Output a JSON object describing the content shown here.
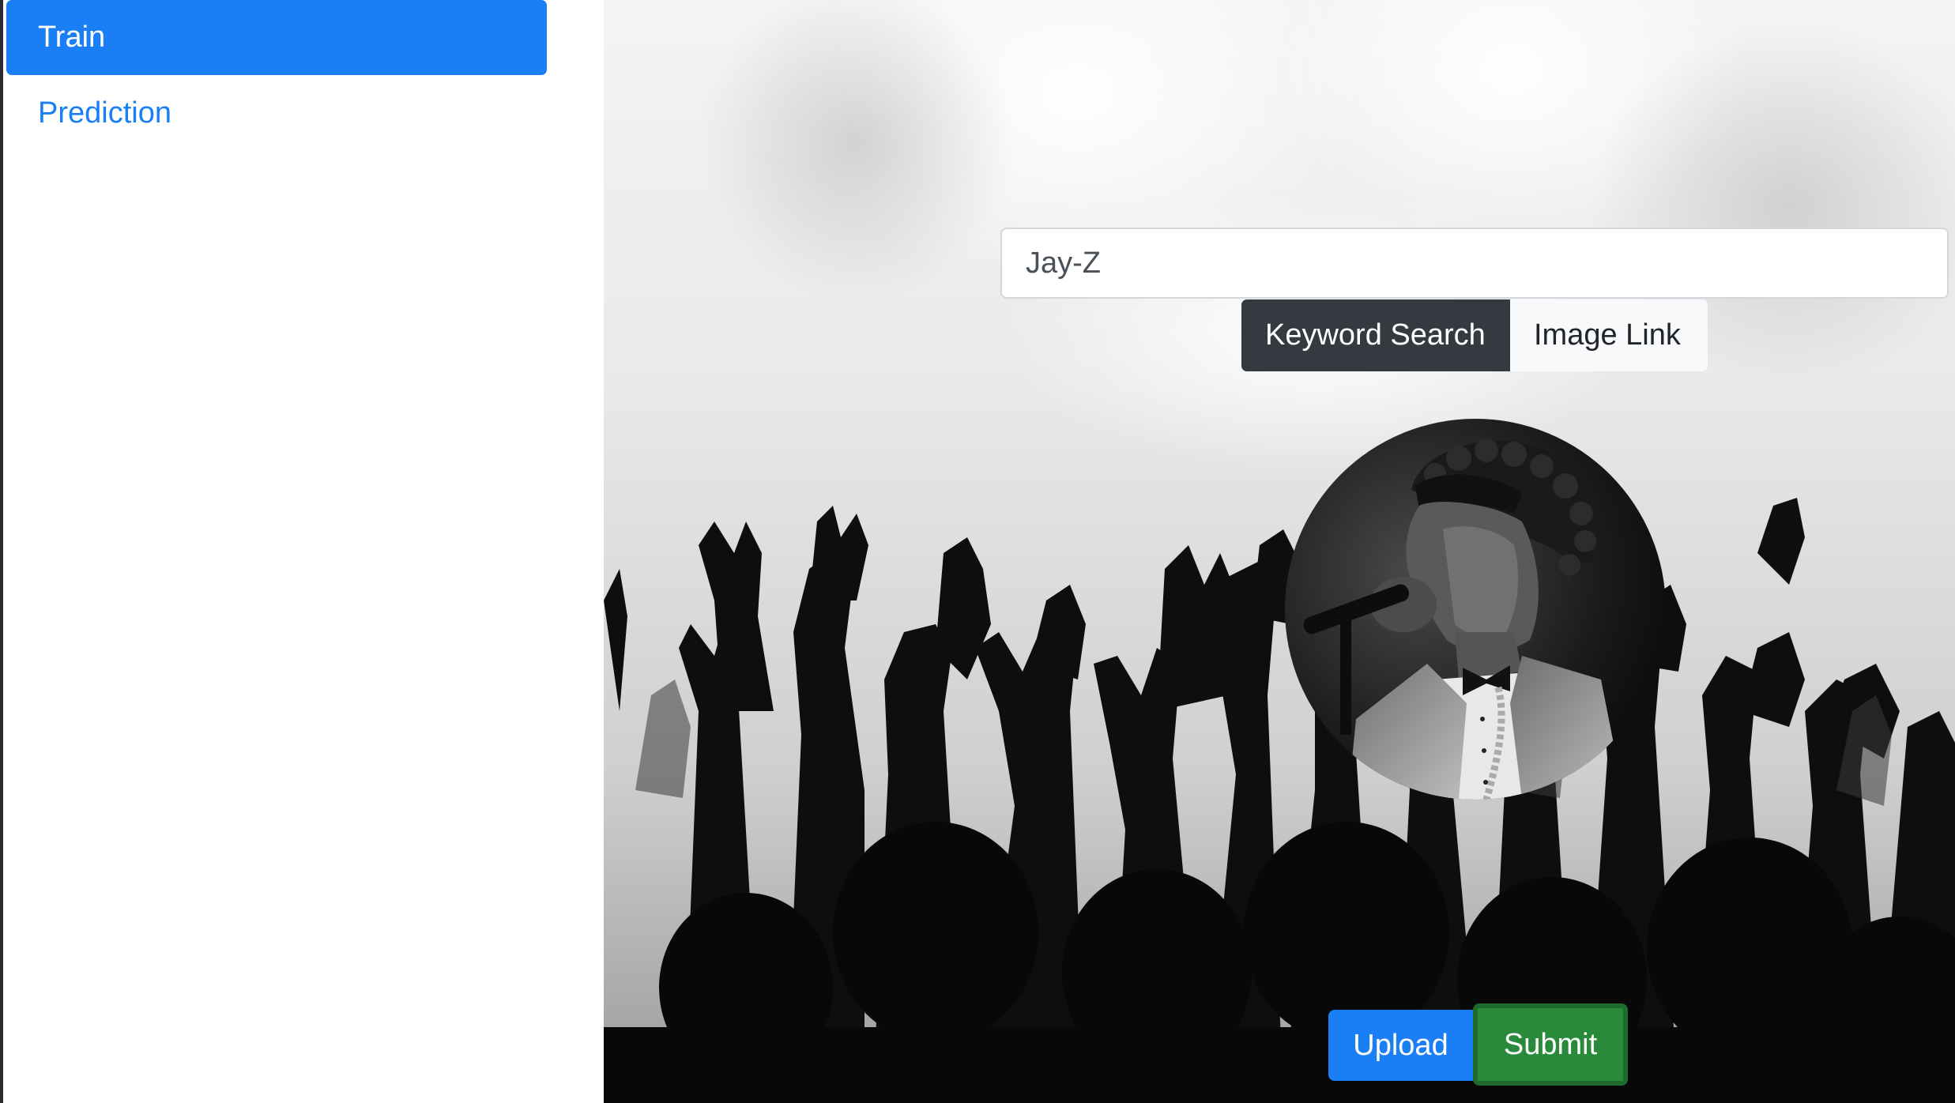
{
  "sidebar": {
    "items": [
      {
        "label": "Train",
        "active": true
      },
      {
        "label": "Prediction",
        "active": false
      }
    ]
  },
  "search": {
    "value": "Jay-Z",
    "placeholder": ""
  },
  "search_mode": {
    "options": [
      "Keyword Search",
      "Image Link"
    ],
    "selected": "Keyword Search"
  },
  "preview": {
    "image_description_icon": "performer-photo"
  },
  "actions": {
    "upload_label": "Upload",
    "submit_label": "Submit"
  },
  "colors": {
    "primary": "#1a7ef5",
    "dark": "#343a40",
    "light": "#f8f9fa",
    "success": "#288a3a"
  }
}
